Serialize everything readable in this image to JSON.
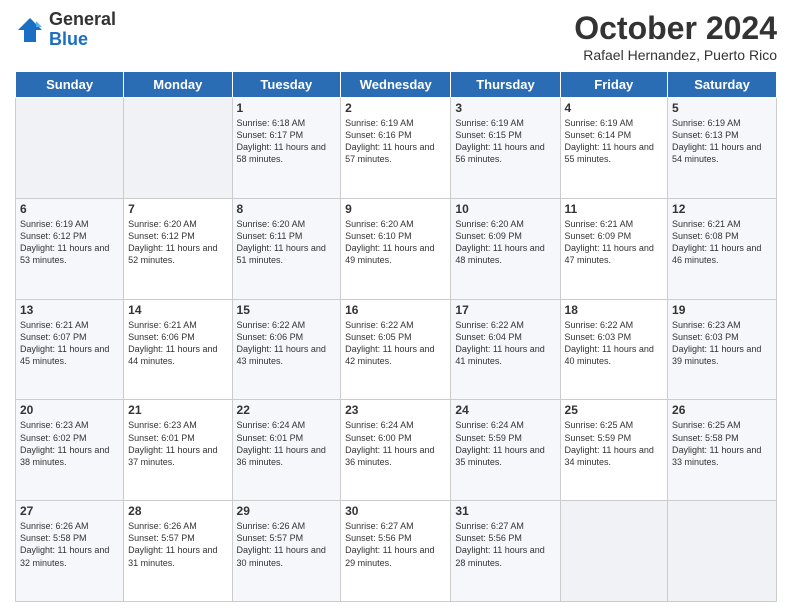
{
  "header": {
    "logo_general": "General",
    "logo_blue": "Blue",
    "month_title": "October 2024",
    "subtitle": "Rafael Hernandez, Puerto Rico"
  },
  "days_of_week": [
    "Sunday",
    "Monday",
    "Tuesday",
    "Wednesday",
    "Thursday",
    "Friday",
    "Saturday"
  ],
  "weeks": [
    [
      {
        "day": "",
        "sunrise": "",
        "sunset": "",
        "daylight": ""
      },
      {
        "day": "",
        "sunrise": "",
        "sunset": "",
        "daylight": ""
      },
      {
        "day": "1",
        "sunrise": "Sunrise: 6:18 AM",
        "sunset": "Sunset: 6:17 PM",
        "daylight": "Daylight: 11 hours and 58 minutes."
      },
      {
        "day": "2",
        "sunrise": "Sunrise: 6:19 AM",
        "sunset": "Sunset: 6:16 PM",
        "daylight": "Daylight: 11 hours and 57 minutes."
      },
      {
        "day": "3",
        "sunrise": "Sunrise: 6:19 AM",
        "sunset": "Sunset: 6:15 PM",
        "daylight": "Daylight: 11 hours and 56 minutes."
      },
      {
        "day": "4",
        "sunrise": "Sunrise: 6:19 AM",
        "sunset": "Sunset: 6:14 PM",
        "daylight": "Daylight: 11 hours and 55 minutes."
      },
      {
        "day": "5",
        "sunrise": "Sunrise: 6:19 AM",
        "sunset": "Sunset: 6:13 PM",
        "daylight": "Daylight: 11 hours and 54 minutes."
      }
    ],
    [
      {
        "day": "6",
        "sunrise": "Sunrise: 6:19 AM",
        "sunset": "Sunset: 6:12 PM",
        "daylight": "Daylight: 11 hours and 53 minutes."
      },
      {
        "day": "7",
        "sunrise": "Sunrise: 6:20 AM",
        "sunset": "Sunset: 6:12 PM",
        "daylight": "Daylight: 11 hours and 52 minutes."
      },
      {
        "day": "8",
        "sunrise": "Sunrise: 6:20 AM",
        "sunset": "Sunset: 6:11 PM",
        "daylight": "Daylight: 11 hours and 51 minutes."
      },
      {
        "day": "9",
        "sunrise": "Sunrise: 6:20 AM",
        "sunset": "Sunset: 6:10 PM",
        "daylight": "Daylight: 11 hours and 49 minutes."
      },
      {
        "day": "10",
        "sunrise": "Sunrise: 6:20 AM",
        "sunset": "Sunset: 6:09 PM",
        "daylight": "Daylight: 11 hours and 48 minutes."
      },
      {
        "day": "11",
        "sunrise": "Sunrise: 6:21 AM",
        "sunset": "Sunset: 6:09 PM",
        "daylight": "Daylight: 11 hours and 47 minutes."
      },
      {
        "day": "12",
        "sunrise": "Sunrise: 6:21 AM",
        "sunset": "Sunset: 6:08 PM",
        "daylight": "Daylight: 11 hours and 46 minutes."
      }
    ],
    [
      {
        "day": "13",
        "sunrise": "Sunrise: 6:21 AM",
        "sunset": "Sunset: 6:07 PM",
        "daylight": "Daylight: 11 hours and 45 minutes."
      },
      {
        "day": "14",
        "sunrise": "Sunrise: 6:21 AM",
        "sunset": "Sunset: 6:06 PM",
        "daylight": "Daylight: 11 hours and 44 minutes."
      },
      {
        "day": "15",
        "sunrise": "Sunrise: 6:22 AM",
        "sunset": "Sunset: 6:06 PM",
        "daylight": "Daylight: 11 hours and 43 minutes."
      },
      {
        "day": "16",
        "sunrise": "Sunrise: 6:22 AM",
        "sunset": "Sunset: 6:05 PM",
        "daylight": "Daylight: 11 hours and 42 minutes."
      },
      {
        "day": "17",
        "sunrise": "Sunrise: 6:22 AM",
        "sunset": "Sunset: 6:04 PM",
        "daylight": "Daylight: 11 hours and 41 minutes."
      },
      {
        "day": "18",
        "sunrise": "Sunrise: 6:22 AM",
        "sunset": "Sunset: 6:03 PM",
        "daylight": "Daylight: 11 hours and 40 minutes."
      },
      {
        "day": "19",
        "sunrise": "Sunrise: 6:23 AM",
        "sunset": "Sunset: 6:03 PM",
        "daylight": "Daylight: 11 hours and 39 minutes."
      }
    ],
    [
      {
        "day": "20",
        "sunrise": "Sunrise: 6:23 AM",
        "sunset": "Sunset: 6:02 PM",
        "daylight": "Daylight: 11 hours and 38 minutes."
      },
      {
        "day": "21",
        "sunrise": "Sunrise: 6:23 AM",
        "sunset": "Sunset: 6:01 PM",
        "daylight": "Daylight: 11 hours and 37 minutes."
      },
      {
        "day": "22",
        "sunrise": "Sunrise: 6:24 AM",
        "sunset": "Sunset: 6:01 PM",
        "daylight": "Daylight: 11 hours and 36 minutes."
      },
      {
        "day": "23",
        "sunrise": "Sunrise: 6:24 AM",
        "sunset": "Sunset: 6:00 PM",
        "daylight": "Daylight: 11 hours and 36 minutes."
      },
      {
        "day": "24",
        "sunrise": "Sunrise: 6:24 AM",
        "sunset": "Sunset: 5:59 PM",
        "daylight": "Daylight: 11 hours and 35 minutes."
      },
      {
        "day": "25",
        "sunrise": "Sunrise: 6:25 AM",
        "sunset": "Sunset: 5:59 PM",
        "daylight": "Daylight: 11 hours and 34 minutes."
      },
      {
        "day": "26",
        "sunrise": "Sunrise: 6:25 AM",
        "sunset": "Sunset: 5:58 PM",
        "daylight": "Daylight: 11 hours and 33 minutes."
      }
    ],
    [
      {
        "day": "27",
        "sunrise": "Sunrise: 6:26 AM",
        "sunset": "Sunset: 5:58 PM",
        "daylight": "Daylight: 11 hours and 32 minutes."
      },
      {
        "day": "28",
        "sunrise": "Sunrise: 6:26 AM",
        "sunset": "Sunset: 5:57 PM",
        "daylight": "Daylight: 11 hours and 31 minutes."
      },
      {
        "day": "29",
        "sunrise": "Sunrise: 6:26 AM",
        "sunset": "Sunset: 5:57 PM",
        "daylight": "Daylight: 11 hours and 30 minutes."
      },
      {
        "day": "30",
        "sunrise": "Sunrise: 6:27 AM",
        "sunset": "Sunset: 5:56 PM",
        "daylight": "Daylight: 11 hours and 29 minutes."
      },
      {
        "day": "31",
        "sunrise": "Sunrise: 6:27 AM",
        "sunset": "Sunset: 5:56 PM",
        "daylight": "Daylight: 11 hours and 28 minutes."
      },
      {
        "day": "",
        "sunrise": "",
        "sunset": "",
        "daylight": ""
      },
      {
        "day": "",
        "sunrise": "",
        "sunset": "",
        "daylight": ""
      }
    ]
  ]
}
